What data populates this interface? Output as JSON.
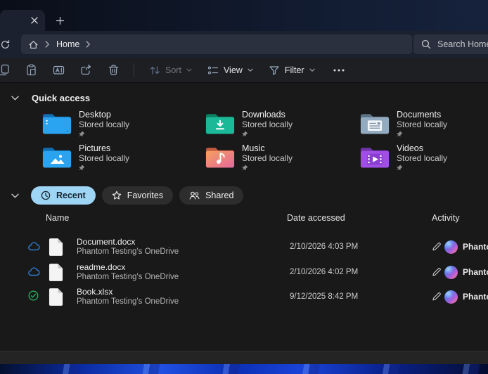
{
  "titlebar": {
    "tab_close_icon": "close-icon",
    "new_tab_icon": "plus-icon"
  },
  "navbar": {
    "refresh_icon": "refresh-icon",
    "breadcrumb": {
      "home_icon": "home-icon",
      "root": "Home"
    },
    "search": {
      "icon": "search-icon",
      "placeholder": "Search Home"
    }
  },
  "toolbar": {
    "buttons": [
      {
        "icon": "copy-icon"
      },
      {
        "icon": "paste-icon"
      },
      {
        "icon": "rename-icon"
      },
      {
        "icon": "share-icon"
      },
      {
        "icon": "delete-icon"
      }
    ],
    "sort_label": "Sort",
    "sort_state": "disabled",
    "view_label": "View",
    "filter_label": "Filter",
    "more_icon": "ellipsis-icon"
  },
  "quick_access": {
    "title": "Quick access",
    "items": [
      {
        "name": "Desktop",
        "status": "Stored locally",
        "pinned": true,
        "folder_color": "#2aa3f0"
      },
      {
        "name": "Downloads",
        "status": "Stored locally",
        "pinned": true,
        "folder_color": "#1cb999"
      },
      {
        "name": "Documents",
        "status": "Stored locally",
        "pinned": true,
        "folder_color": "#93abc0"
      },
      {
        "name": "Pictures",
        "status": "Stored locally",
        "pinned": true,
        "folder_color": "#2aa3f0"
      },
      {
        "name": "Music",
        "status": "Stored locally",
        "pinned": true,
        "folder_color": "#ef8a6e"
      },
      {
        "name": "Videos",
        "status": "Stored locally",
        "pinned": true,
        "folder_color": "#a14ee6"
      }
    ]
  },
  "filter_pills": [
    {
      "label": "Recent",
      "icon": "clock-icon",
      "active": true
    },
    {
      "label": "Favorites",
      "icon": "star-icon",
      "active": false
    },
    {
      "label": "Shared",
      "icon": "people-icon",
      "active": false
    }
  ],
  "recent": {
    "headers": {
      "name": "Name",
      "date": "Date accessed",
      "activity": "Activity"
    },
    "rows": [
      {
        "name": "Document.docx",
        "location": "Phantom Testing's OneDrive",
        "date": "2/10/2026 4:03 PM",
        "activity": "Phantom",
        "sync": "cloud-online"
      },
      {
        "name": "readme.docx",
        "location": "Phantom Testing's OneDrive",
        "date": "2/10/2026 4:02 PM",
        "activity": "Phantom",
        "sync": "cloud-online"
      },
      {
        "name": "Book.xlsx",
        "location": "Phantom Testing's OneDrive",
        "date": "9/12/2025 8:42 PM",
        "activity": "Phantom",
        "sync": "synced"
      }
    ]
  },
  "colors": {
    "active_pill": "#9ed5f5",
    "cloud_blue": "#2f7fd6",
    "synced_green": "#2aab5e",
    "toolbar_icon": "#97a9c0"
  }
}
